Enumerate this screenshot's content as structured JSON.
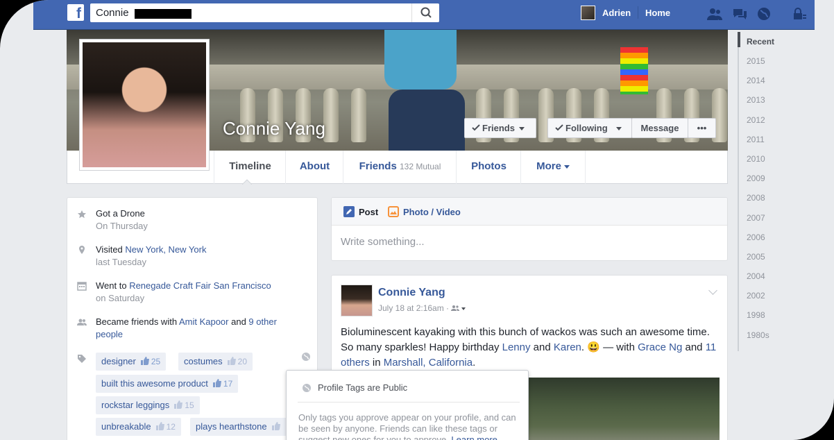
{
  "topbar": {
    "logo": "f",
    "search_value": "Connie",
    "user_name": "Adrien",
    "home_label": "Home"
  },
  "profile": {
    "name": "Connie Yang",
    "buttons": {
      "friends": "Friends",
      "following": "Following",
      "message": "Message",
      "more": "•••"
    },
    "tabs": [
      {
        "label": "Timeline"
      },
      {
        "label": "About"
      },
      {
        "label": "Friends",
        "sub": "132 Mutual"
      },
      {
        "label": "Photos"
      },
      {
        "label": "More"
      }
    ]
  },
  "years": [
    "Recent",
    "2015",
    "2014",
    "2013",
    "2012",
    "2011",
    "2010",
    "2009",
    "2008",
    "2007",
    "2006",
    "2005",
    "2004",
    "2002",
    "1998",
    "1980s"
  ],
  "activity": [
    {
      "icon": "star-icon",
      "main": "Got a Drone",
      "sub": "On Thursday"
    },
    {
      "icon": "location-pin-icon",
      "prefix": "Visited ",
      "link": "New York, New York",
      "sub": "last Tuesday"
    },
    {
      "icon": "calendar-icon",
      "prefix": "Went to ",
      "link": "Renegade Craft Fair San Francisco",
      "sub": "on Saturday"
    },
    {
      "icon": "friends-icon",
      "prefix": "Became friends with ",
      "link": "Amit Kapoor",
      "mid": " and ",
      "link2": "9 other",
      "link3": "people"
    }
  ],
  "tags": [
    {
      "label": "designer",
      "count": "25"
    },
    {
      "label": "costumes",
      "count": "20"
    },
    {
      "label": "built this awesome product",
      "count": "17"
    },
    {
      "label": "rockstar leggings",
      "count": "15"
    },
    {
      "label": "unbreakable",
      "count": "12"
    },
    {
      "label": "plays hearthstone",
      "count": ""
    }
  ],
  "composer": {
    "post_tab": "Post",
    "photo_tab": "Photo / Video",
    "placeholder": "Write something..."
  },
  "post": {
    "author": "Connie Yang",
    "meta": "July 18 at 2:16am ·",
    "text_1": "Bioluminescent kayaking with this bunch of wackos was such an awesome time. So many sparkles! Happy birthday ",
    "link_lenny": "Lenny",
    "and_1": " and ",
    "link_karen": "Karen",
    "text_2": ". 😃 — with ",
    "link_grace": "Grace Ng",
    "and_2": " and ",
    "link_others": "11 others",
    "in": " in ",
    "link_place": "Marshall, California",
    "end": "."
  },
  "tooltip": {
    "title": "Profile Tags are Public",
    "body": "Only tags you approve appear on your profile, and can be seen by anyone. Friends can like these tags or suggest new ones for you to approve. ",
    "link": "Learn more"
  },
  "colors": {
    "brand": "#4267b2",
    "link": "#365899",
    "page_bg": "#e9ebee"
  }
}
